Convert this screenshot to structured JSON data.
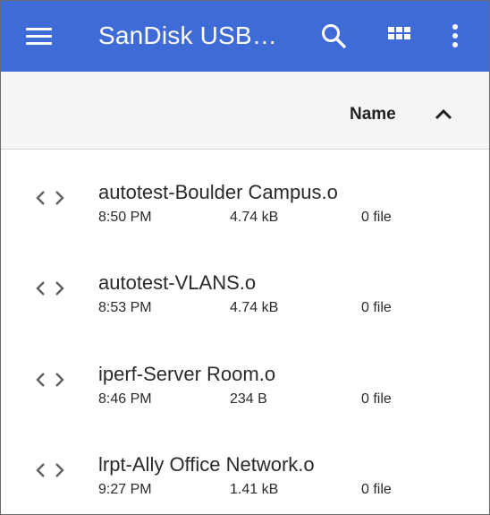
{
  "app_bar": {
    "title": "SanDisk USB…",
    "menu_icon": "hamburger-menu-icon",
    "search_icon": "search-icon",
    "grid_icon": "grid-view-icon",
    "more_icon": "more-vertical-icon",
    "color": "#3f6bd6"
  },
  "sort_bar": {
    "label": "Name",
    "direction_icon": "chevron-up-icon"
  },
  "files": [
    {
      "name": "autotest-Boulder Campus.o",
      "time": "8:50 PM",
      "size": "4.74 kB",
      "count": "0 file",
      "icon": "code-brackets-icon"
    },
    {
      "name": "autotest-VLANS.o",
      "time": "8:53 PM",
      "size": "4.74 kB",
      "count": "0 file",
      "icon": "code-brackets-icon"
    },
    {
      "name": "iperf-Server Room.o",
      "time": "8:46 PM",
      "size": "234 B",
      "count": "0 file",
      "icon": "code-brackets-icon"
    },
    {
      "name": "lrpt-Ally Office Network.o",
      "time": "9:27 PM",
      "size": "1.41 kB",
      "count": "0 file",
      "icon": "code-brackets-icon"
    }
  ]
}
